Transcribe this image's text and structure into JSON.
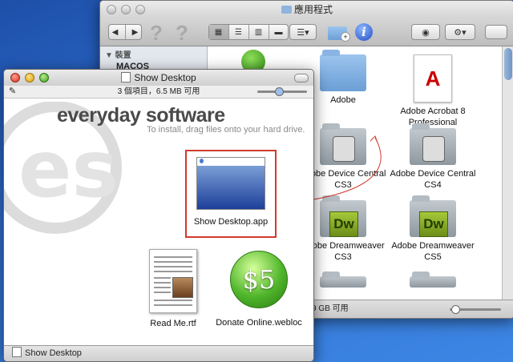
{
  "finder": {
    "title": "應用程式",
    "sidebar": {
      "section_header": "▼ 裝置",
      "items": [
        "MACOS"
      ]
    },
    "items": [
      {
        "label": "",
        "kind": "green-app"
      },
      {
        "label": "Adobe",
        "kind": "folder"
      },
      {
        "label": "Adobe Acrobat 8 Professional",
        "kind": "acrobat"
      },
      {
        "label": "",
        "kind": "gray-folder"
      },
      {
        "label": "Adobe Device Central CS3",
        "kind": "device-folder"
      },
      {
        "label": "Adobe Device Central CS4",
        "kind": "device-folder"
      },
      {
        "label": "",
        "kind": "blank"
      },
      {
        "label": "Adobe Dreamweaver CS3",
        "kind": "dw"
      },
      {
        "label": "Adobe Dreamweaver CS5",
        "kind": "dw"
      }
    ],
    "dw_glyph": "Dw",
    "acrobat_glyph": "A",
    "status_text": "9 GB 可用"
  },
  "dmg": {
    "title": "Show Desktop",
    "info": "3 個項目，6.5 MB 可用",
    "brand": "everyday software",
    "tagline": "To install, drag files onto your hard drive.",
    "app_label": "Show Desktop.app",
    "rtf_label": "Read Me.rtf",
    "donate_label": "Donate Online.webloc",
    "donate_glyph": "$5",
    "status_label": "Show Desktop"
  },
  "colors": {
    "highlight_box": "#d03a2f",
    "drag_arrow": "#d03a2f",
    "desktop": "#2f6fd0"
  }
}
